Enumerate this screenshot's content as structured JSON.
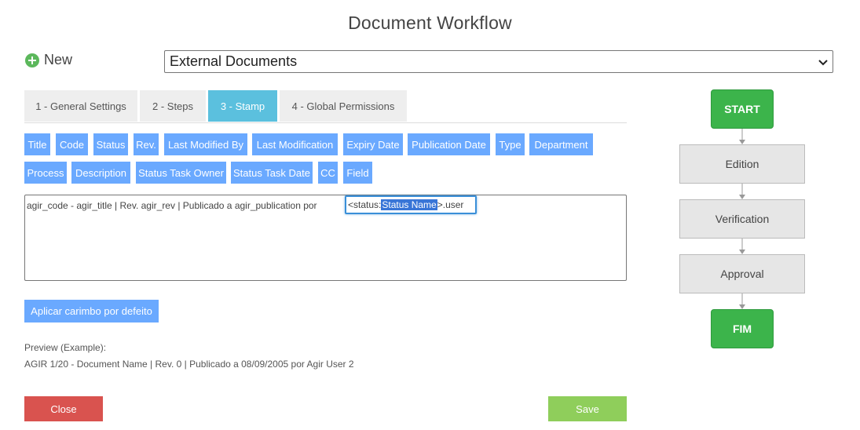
{
  "page": {
    "title": "Document Workflow"
  },
  "header": {
    "new_label": "New",
    "select_value": "External Documents"
  },
  "tabs": [
    {
      "label": "1 - General Settings"
    },
    {
      "label": "2 - Steps"
    },
    {
      "label": "3 - Stamp"
    },
    {
      "label": "4 - Global Permissions"
    }
  ],
  "active_tab": "3 - Stamp",
  "fields": [
    "Title",
    "Code",
    "Status",
    "Rev.",
    "Last Modified By",
    "Last Modification",
    "Expiry Date",
    "Publication Date",
    "Type",
    "Department",
    "Process",
    "Description",
    "Status Task Owner",
    "Status Task Date",
    "CC",
    "Field"
  ],
  "editor": {
    "text": "agir_code - agir_title | Rev. agir_rev | Publicado a agir_publication por",
    "highlight_prefix": "<status:",
    "highlight_selected": "Status Name",
    "highlight_suffix": ">.user"
  },
  "apply_label": "Aplicar carimbo por defeito",
  "preview": {
    "label": "Preview (Example):",
    "text": "AGIR 1/20 - Document Name | Rev. 0 | Publicado a 08/09/2005 por Agir User 2"
  },
  "buttons": {
    "close": "Close",
    "save": "Save"
  },
  "workflow": {
    "start": "START",
    "steps": [
      "Edition",
      "Verification",
      "Approval"
    ],
    "end": "FIM"
  },
  "colors": {
    "tab_active": "#5bc0de",
    "field_tag": "#6aa9ff",
    "close": "#d9534f",
    "save": "#8fce5b",
    "wf_terminal": "#3cb44b"
  }
}
